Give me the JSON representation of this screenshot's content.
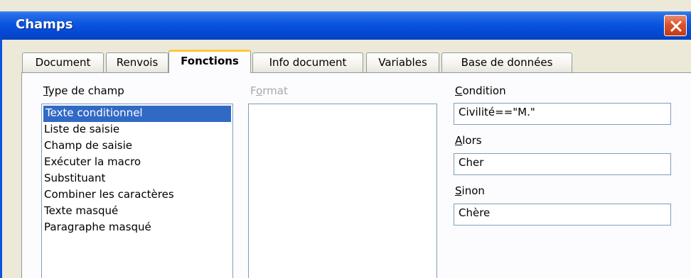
{
  "window": {
    "title": "Champs"
  },
  "tabs": [
    {
      "label": "Document",
      "active": false
    },
    {
      "label": "Renvois",
      "active": false
    },
    {
      "label": "Fonctions",
      "active": true
    },
    {
      "label": "Info document",
      "active": false
    },
    {
      "label": "Variables",
      "active": false
    },
    {
      "label": "Base de données",
      "active": false
    }
  ],
  "field_type": {
    "label_access_key": "T",
    "label_rest": "ype de champ",
    "items": [
      "Texte conditionnel",
      "Liste de saisie",
      "Champ de saisie",
      "Exécuter la macro",
      "Substituant",
      "Combiner les caractères",
      "Texte masqué",
      "Paragraphe masqué"
    ],
    "selected_index": 0
  },
  "format": {
    "label_first": "F",
    "label_access_key": "o",
    "label_rest": "rmat"
  },
  "condition": {
    "label_access_key": "C",
    "label_rest": "ondition",
    "value": "Civilité==\"M.\""
  },
  "then": {
    "label_access_key": "A",
    "label_rest": "lors",
    "value": "Cher"
  },
  "else": {
    "label_access_key": "S",
    "label_rest": "inon",
    "value": "Chère"
  },
  "colors": {
    "titlebar": "#0a55df",
    "selection": "#316ac5",
    "active_tab_accent": "#ffc83c",
    "close_button": "#d9542d"
  }
}
